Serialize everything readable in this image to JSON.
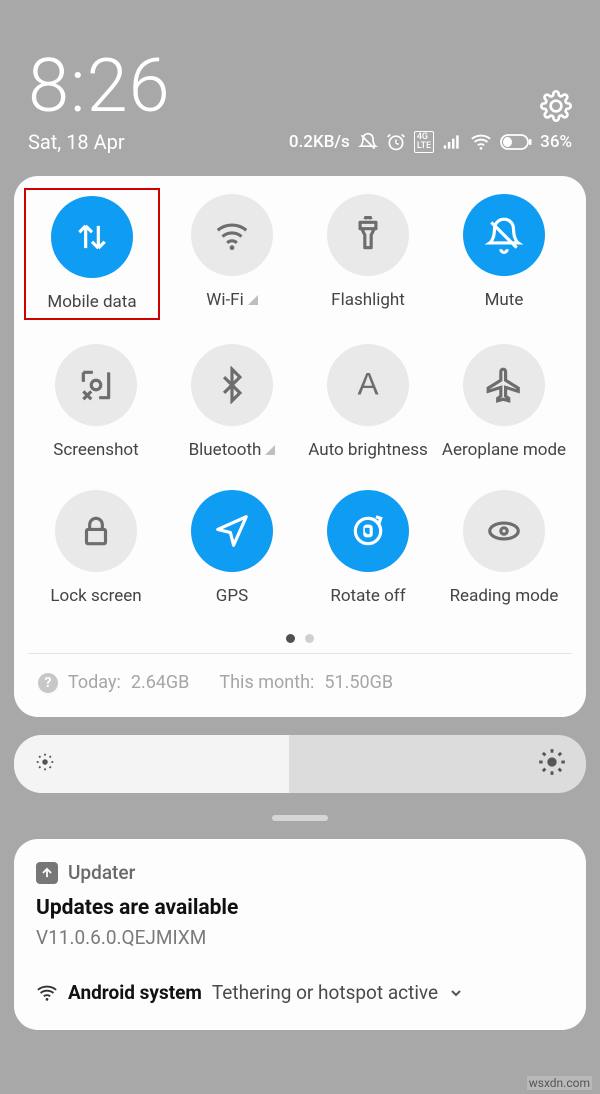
{
  "status": {
    "time": "8:26",
    "date": "Sat, 18 Apr",
    "net_speed": "0.2KB/s",
    "battery_pct": "36%",
    "lte_label": "4G LTE"
  },
  "toggles": [
    {
      "label": "Mobile data",
      "active": true,
      "icon": "data",
      "chevron": false,
      "highlight": true
    },
    {
      "label": "Wi-Fi",
      "active": false,
      "icon": "wifi",
      "chevron": true,
      "highlight": false
    },
    {
      "label": "Flashlight",
      "active": false,
      "icon": "flashlight",
      "chevron": false,
      "highlight": false
    },
    {
      "label": "Mute",
      "active": true,
      "icon": "mute",
      "chevron": false,
      "highlight": false
    },
    {
      "label": "Screenshot",
      "active": false,
      "icon": "screenshot",
      "chevron": false,
      "highlight": false
    },
    {
      "label": "Bluetooth",
      "active": false,
      "icon": "bluetooth",
      "chevron": true,
      "highlight": false
    },
    {
      "label": "Auto brightness",
      "active": false,
      "icon": "auto-bright",
      "chevron": false,
      "highlight": false
    },
    {
      "label": "Aeroplane mode",
      "active": false,
      "icon": "airplane",
      "chevron": false,
      "highlight": false
    },
    {
      "label": "Lock screen",
      "active": false,
      "icon": "lock",
      "chevron": false,
      "highlight": false
    },
    {
      "label": "GPS",
      "active": true,
      "icon": "gps",
      "chevron": false,
      "highlight": false
    },
    {
      "label": "Rotate off",
      "active": true,
      "icon": "rotate",
      "chevron": false,
      "highlight": false
    },
    {
      "label": "Reading mode",
      "active": false,
      "icon": "reading",
      "chevron": false,
      "highlight": false
    }
  ],
  "pager": {
    "pages": 2,
    "current": 0
  },
  "usage": {
    "today_label": "Today:",
    "today_value": "2.64GB",
    "month_label": "This month:",
    "month_value": "51.50GB"
  },
  "brightness": {
    "level_pct": 48
  },
  "notifications": {
    "updater": {
      "app": "Updater",
      "title": "Updates are available",
      "version": "V11.0.6.0.QEJMIXM"
    },
    "system": {
      "app": "Android system",
      "text": "Tethering or hotspot active"
    }
  },
  "watermark": "wsxdn.com"
}
